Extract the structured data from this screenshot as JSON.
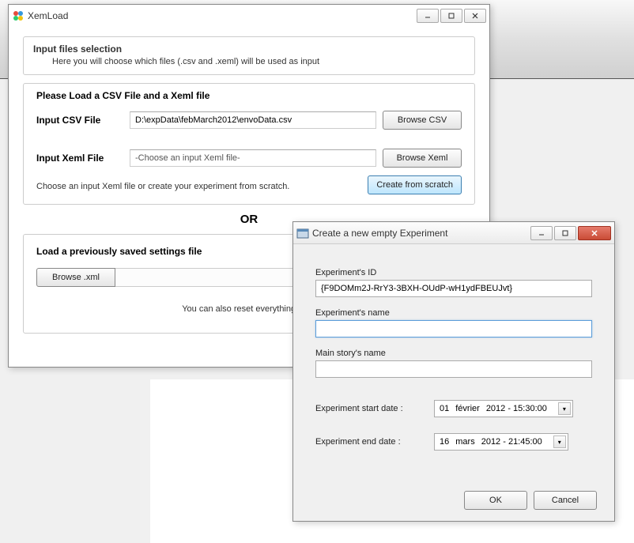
{
  "main_window": {
    "title": "XemLoad",
    "input_section": {
      "header": "Input files selection",
      "sub": "Here you will choose which files (.csv and .xeml) will be used as input"
    },
    "load_title": "Please Load a CSV File and a Xeml file",
    "csv_label": "Input CSV File",
    "csv_value": "D:\\expData\\febMarch2012\\envoData.csv",
    "browse_csv": "Browse CSV",
    "xeml_label": "Input Xeml File",
    "xeml_value": "-Choose an input Xeml file-",
    "browse_xeml": "Browse Xeml",
    "xeml_hint": "Choose an input Xeml file or create your experiment from scratch.",
    "create_scratch": "Create from scratch",
    "or_label": "OR",
    "saved_title": "Load a previously saved settings file",
    "browse_xml": "Browse .xml",
    "reset_text": "You can also reset everything by cl"
  },
  "dialog": {
    "title": "Create a new empty Experiment",
    "id_label": "Experiment's ID",
    "id_value": "{F9DOMm2J-RrY3-3BXH-OUdP-wH1ydFBEUJvt}",
    "name_label": "Experiment's name",
    "name_value": "",
    "story_label": "Main story's name",
    "story_value": "",
    "start_label": "Experiment start date :",
    "start_day": "01",
    "start_month": "février",
    "start_rest": "2012 - 15:30:00",
    "end_label": "Experiment end date :",
    "end_day": "16",
    "end_month": "mars",
    "end_rest": "2012 - 21:45:00",
    "ok": "OK",
    "cancel": "Cancel"
  }
}
